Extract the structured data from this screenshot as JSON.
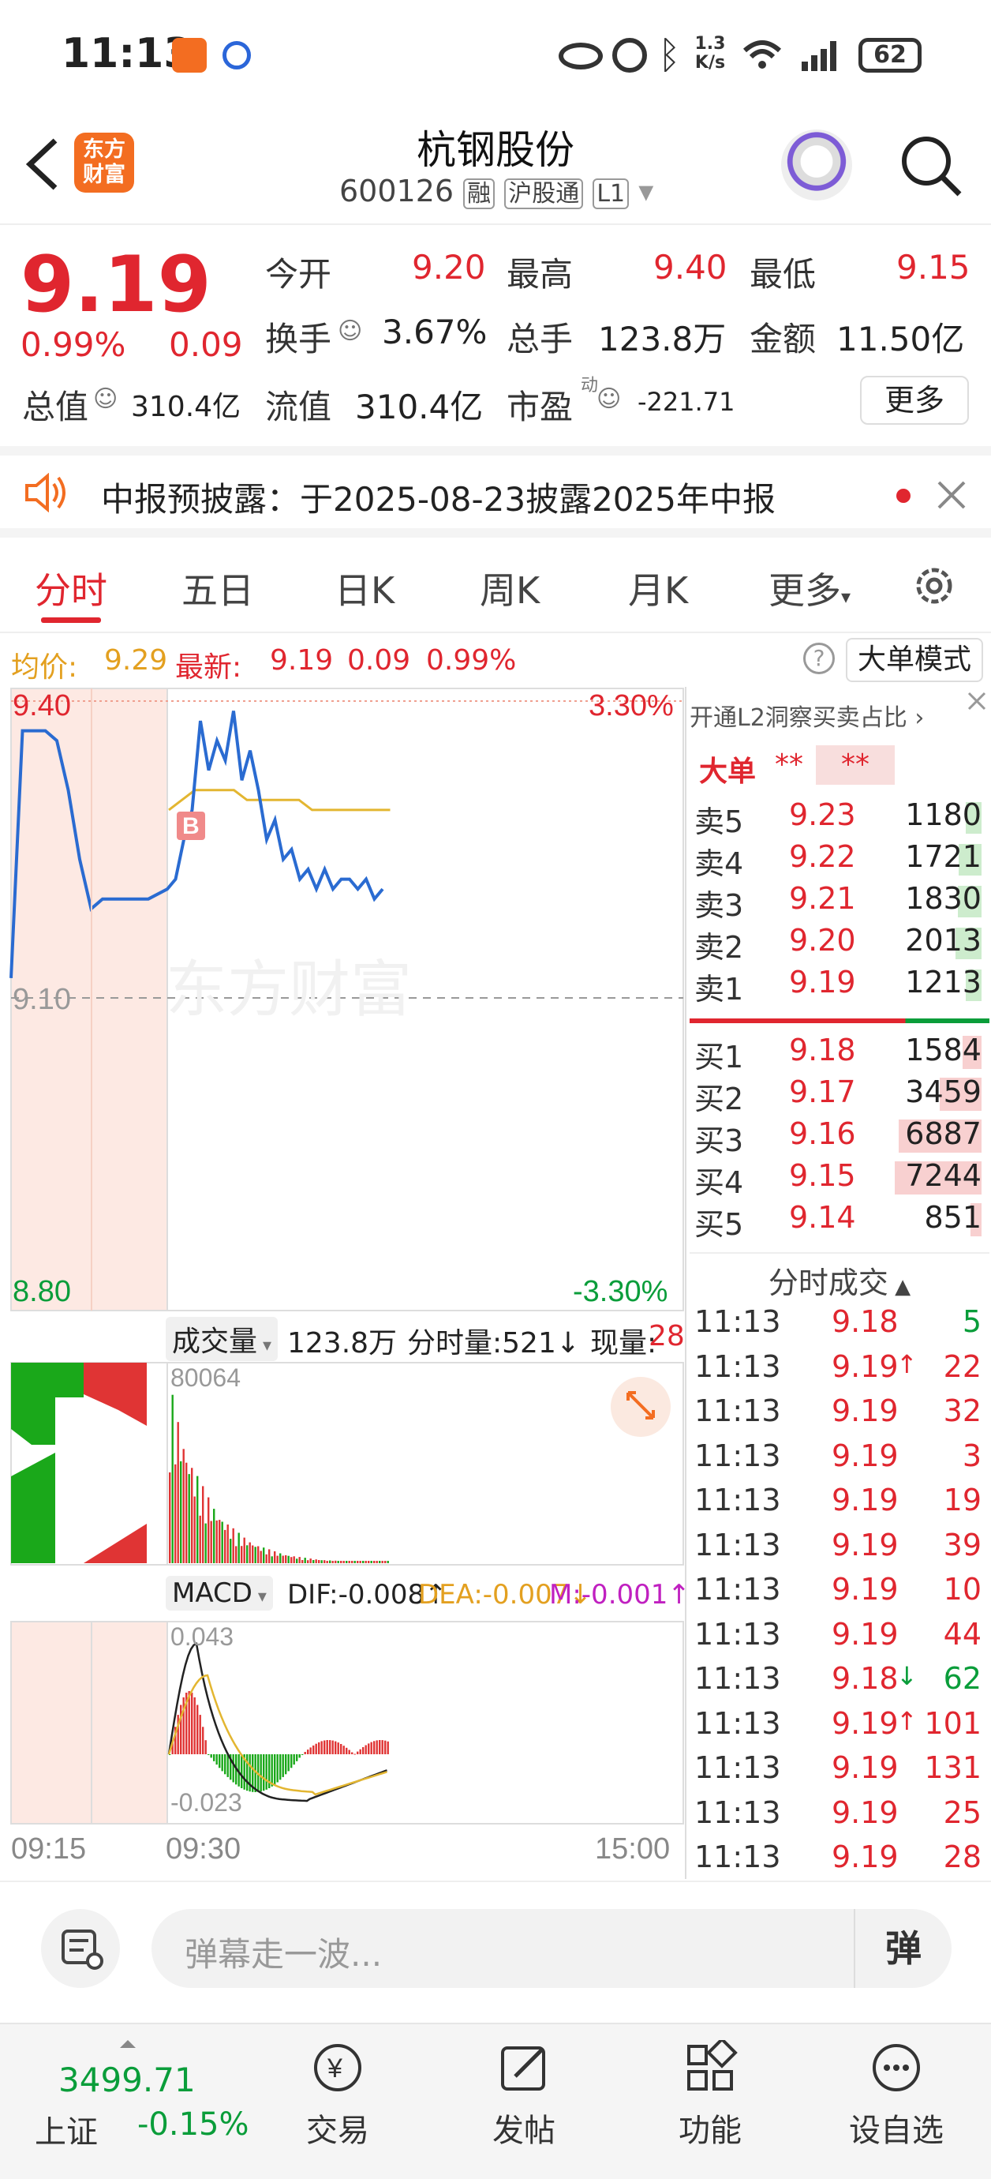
{
  "status_bar": {
    "time": "11:13",
    "net_speed_top": "1.3",
    "net_speed_unit": "K/s",
    "battery": "62"
  },
  "header": {
    "title": "杭钢股份",
    "code": "600126",
    "tags": [
      "融",
      "沪股通",
      "L1"
    ],
    "logo_line1": "东方",
    "logo_line2": "财富"
  },
  "quote": {
    "price": "9.19",
    "change_pct": "0.99%",
    "change": "0.09",
    "open_label": "今开",
    "open": "9.20",
    "high_label": "最高",
    "high": "9.40",
    "low_label": "最低",
    "low": "9.15",
    "turnover_label": "换手",
    "turnover": "3.67%",
    "volume_label": "总手",
    "volume": "123.8万",
    "amount_label": "金额",
    "amount": "11.50亿",
    "mcap_label": "总值",
    "mcap": "310.4亿",
    "float_label": "流值",
    "float": "310.4亿",
    "pe_label": "市盈",
    "pe_sup": "动",
    "pe": "-221.71",
    "more_button": "更多"
  },
  "notice": {
    "text": "中报预披露：于2025-08-23披露2025年中报"
  },
  "tabs": [
    "分时",
    "五日",
    "日K",
    "周K",
    "月K",
    "更多"
  ],
  "active_tab": "分时",
  "info_line": {
    "avg_label": "均价:",
    "avg": "9.29",
    "latest_label": "最新:",
    "latest": "9.19",
    "change": "0.09",
    "change_pct": "0.99%",
    "big_order_button": "大单模式"
  },
  "chart_data": {
    "type": "line",
    "price_axis": {
      "top": "9.40",
      "mid": "9.10",
      "bottom": "8.80"
    },
    "pct_axis": {
      "top": "3.30%",
      "bottom": "-3.30%"
    },
    "watermark": "东方财富",
    "x_labels": [
      "09:15",
      "09:30",
      "15:00"
    ],
    "series": [
      {
        "values": [
          9.12,
          9.37,
          9.37,
          9.37,
          9.36,
          9.31,
          9.24,
          9.19,
          9.2,
          9.2,
          9.2,
          9.2,
          9.2,
          9.21,
          9.22,
          9.26,
          9.29,
          9.38,
          9.33,
          9.36,
          9.34,
          9.39,
          9.32,
          9.35,
          9.31,
          9.26,
          9.28,
          9.24,
          9.25,
          9.22,
          9.23,
          9.21,
          9.23,
          9.21,
          9.22,
          9.22,
          9.21,
          9.22,
          9.2,
          9.21
        ]
      },
      {
        "values": [
          9.29,
          9.3,
          9.31,
          9.31,
          9.31,
          9.31,
          9.3,
          9.3,
          9.3,
          9.3,
          9.3,
          9.29,
          9.29,
          9.29,
          9.29,
          9.29,
          9.29,
          9.29
        ]
      }
    ],
    "marker": "B"
  },
  "volume_panel": {
    "label": "成交量",
    "total": "123.8万",
    "minute_vol": "分时量:521↓",
    "now_vol_label": "现量:",
    "now_vol": "28",
    "max_label": "80064"
  },
  "macd_panel": {
    "label": "MACD",
    "dif": "DIF:-0.008↑",
    "dea": "DEA:-0.007↓",
    "m": "M:-0.001↑",
    "top_label": "0.043",
    "bottom_label": "-0.023"
  },
  "order_book": {
    "header": "开通L2洞察买卖占比",
    "big_label": "大单",
    "big_val1": "**",
    "big_val2": "**",
    "asks": [
      {
        "label": "卖5",
        "price": "9.23",
        "vol": "1180"
      },
      {
        "label": "卖4",
        "price": "9.22",
        "vol": "1721"
      },
      {
        "label": "卖3",
        "price": "9.21",
        "vol": "1830"
      },
      {
        "label": "卖2",
        "price": "9.20",
        "vol": "2013"
      },
      {
        "label": "卖1",
        "price": "9.19",
        "vol": "1213"
      }
    ],
    "bids": [
      {
        "label": "买1",
        "price": "9.18",
        "vol": "1584"
      },
      {
        "label": "买2",
        "price": "9.17",
        "vol": "3459"
      },
      {
        "label": "买3",
        "price": "9.16",
        "vol": "6887"
      },
      {
        "label": "买4",
        "price": "9.15",
        "vol": "7244"
      },
      {
        "label": "买5",
        "price": "9.14",
        "vol": "851"
      }
    ],
    "ticks_header": "分时成交",
    "ticks": [
      {
        "time": "11:13",
        "price": "9.18",
        "arrow": "",
        "vol": "5",
        "vc": "green"
      },
      {
        "time": "11:13",
        "price": "9.19",
        "arrow": "↑",
        "vol": "22",
        "vc": "red"
      },
      {
        "time": "11:13",
        "price": "9.19",
        "arrow": "",
        "vol": "32",
        "vc": "red"
      },
      {
        "time": "11:13",
        "price": "9.19",
        "arrow": "",
        "vol": "3",
        "vc": "red"
      },
      {
        "time": "11:13",
        "price": "9.19",
        "arrow": "",
        "vol": "19",
        "vc": "red"
      },
      {
        "time": "11:13",
        "price": "9.19",
        "arrow": "",
        "vol": "39",
        "vc": "red"
      },
      {
        "time": "11:13",
        "price": "9.19",
        "arrow": "",
        "vol": "10",
        "vc": "red"
      },
      {
        "time": "11:13",
        "price": "9.19",
        "arrow": "",
        "vol": "44",
        "vc": "red"
      },
      {
        "time": "11:13",
        "price": "9.18",
        "arrow": "↓",
        "vol": "62",
        "vc": "green"
      },
      {
        "time": "11:13",
        "price": "9.19",
        "arrow": "↑",
        "vol": "101",
        "vc": "red"
      },
      {
        "time": "11:13",
        "price": "9.19",
        "arrow": "",
        "vol": "131",
        "vc": "red"
      },
      {
        "time": "11:13",
        "price": "9.19",
        "arrow": "",
        "vol": "25",
        "vc": "red"
      },
      {
        "time": "11:13",
        "price": "9.19",
        "arrow": "",
        "vol": "28",
        "vc": "red"
      }
    ]
  },
  "danmu": {
    "placeholder": "弹幕走一波...",
    "button": "弹"
  },
  "bottom_nav": {
    "index_value": "3499.71",
    "index_name": "上证",
    "index_change": "-0.15%",
    "items": [
      "交易",
      "发帖",
      "功能",
      "设自选"
    ]
  },
  "colors": {
    "up": "#e0262f",
    "down": "#0a9d3a",
    "price_line": "#2a6bd1",
    "avg_line": "#e3b631",
    "brand": "#f36d21"
  }
}
